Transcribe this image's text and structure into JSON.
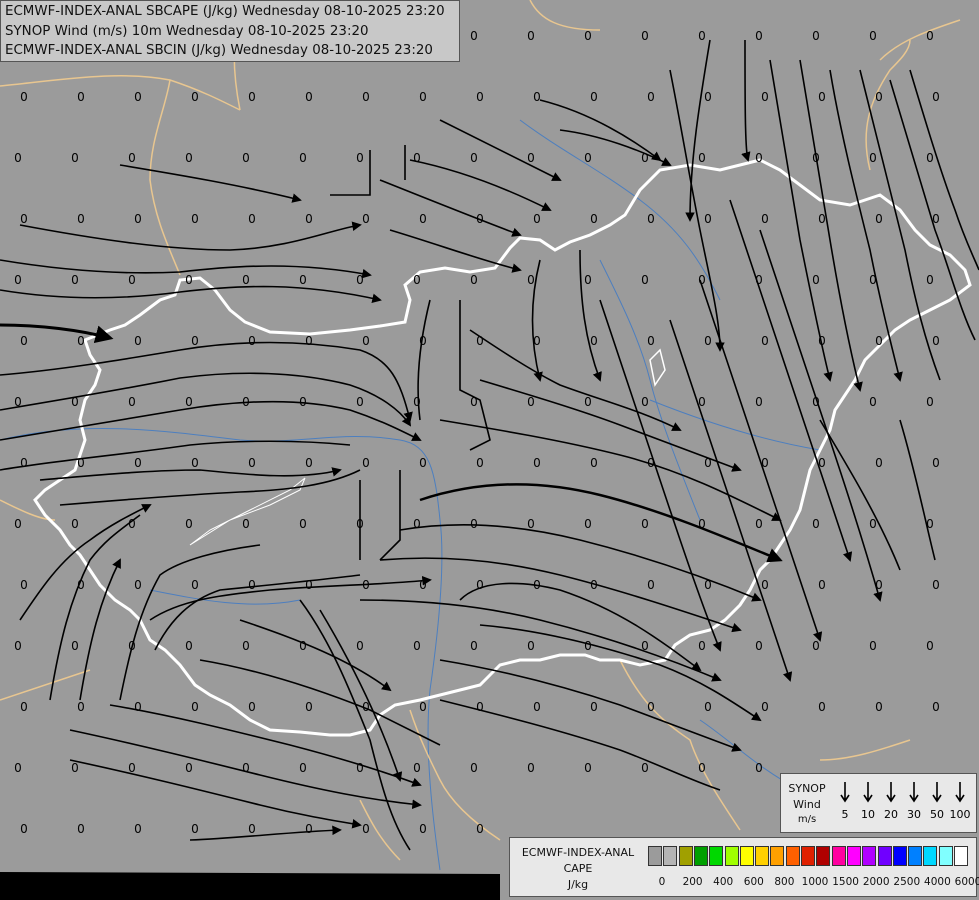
{
  "titles": {
    "line1": "ECMWF-INDEX-ANAL SBCAPE (J/kg) Wednesday 08-10-2025 23:20",
    "line2": "SYNOP Wind (m/s) 10m Wednesday 08-10-2025 23:20",
    "line3": "ECMWF-INDEX-ANAL SBCIN (J/kg) Wednesday 08-10-2025 23:20"
  },
  "wind_legend": {
    "label_line1": "SYNOP",
    "label_line2": "Wind",
    "label_line3": "m/s",
    "speeds": [
      "5",
      "10",
      "20",
      "30",
      "50",
      "100"
    ]
  },
  "cape_legend": {
    "title_line1": "ECMWF-INDEX-ANAL",
    "title_line2": "CAPE",
    "title_line3": "J/kg",
    "ticks": [
      "0",
      "200",
      "400",
      "600",
      "800",
      "1000",
      "1500",
      "2000",
      "2500",
      "4000",
      "6000"
    ],
    "colors": [
      "#9b9b9b",
      "#b4b4b4",
      "#a0a000",
      "#00a000",
      "#00d800",
      "#a0ff00",
      "#ffff00",
      "#ffd000",
      "#ffa000",
      "#ff6000",
      "#e02000",
      "#b00000",
      "#ff00a0",
      "#ff00ff",
      "#b000ff",
      "#7000ff",
      "#0000ff",
      "#0080ff",
      "#00d8ff",
      "#80ffff",
      "#ffffff"
    ]
  },
  "map": {
    "background_color": "#9b9b9b",
    "country_border_color": "#ffffff",
    "neighbour_border_color": "#e8c690",
    "river_color": "#3a78c8",
    "streamline_color": "#000000",
    "value_label": "0"
  }
}
